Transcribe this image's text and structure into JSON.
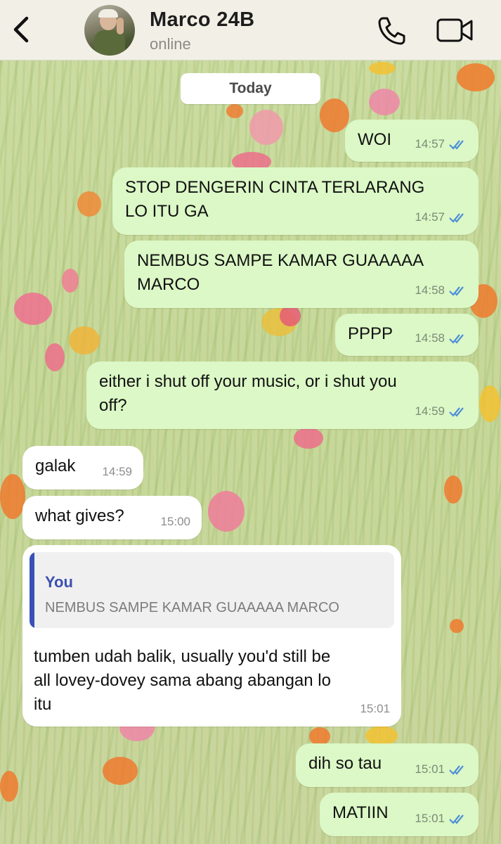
{
  "header": {
    "contact_name": "Marco 24B",
    "status": "online",
    "icons": [
      "back-chevron-icon",
      "phone-icon",
      "video-camera-icon"
    ]
  },
  "chat": {
    "date_label": "Today",
    "messages": [
      {
        "direction": "outgoing",
        "text": "WOI",
        "time": "14:57",
        "read": true
      },
      {
        "direction": "outgoing",
        "text": "STOP DENGERIN CINTA TERLARANG\nLO ITU GA",
        "time": "14:57",
        "read": true
      },
      {
        "direction": "outgoing",
        "text": "NEMBUS SAMPE KAMAR GUAAAAA\nMARCO",
        "time": "14:58",
        "read": true
      },
      {
        "direction": "outgoing",
        "text": "PPPP",
        "time": "14:58",
        "read": true
      },
      {
        "direction": "outgoing",
        "text": "either i shut off your music, or i shut you\noff?",
        "time": "14:59",
        "read": true
      },
      {
        "direction": "incoming",
        "text": "galak",
        "time": "14:59"
      },
      {
        "direction": "incoming",
        "text": "what gives?",
        "time": "15:00"
      },
      {
        "direction": "incoming",
        "text": "tumben udah balik, usually you'd still be\nall lovey-dovey sama abang abangan lo\nitu",
        "time": "15:01",
        "reply_to": {
          "author": "You",
          "text": "NEMBUS SAMPE KAMAR GUAAAAA MARCO"
        }
      },
      {
        "direction": "outgoing",
        "text": "dih so tau",
        "time": "15:01",
        "read": true
      },
      {
        "direction": "outgoing",
        "text": "MATIIN",
        "time": "15:01",
        "read": true
      }
    ]
  },
  "colors": {
    "outgoing_bubble": "#dbf8c6",
    "incoming_bubble": "#ffffff",
    "read_ticks": "#4f8ed8",
    "quote_accent": "#3950b8",
    "header_bg": "#f2f0e6"
  }
}
